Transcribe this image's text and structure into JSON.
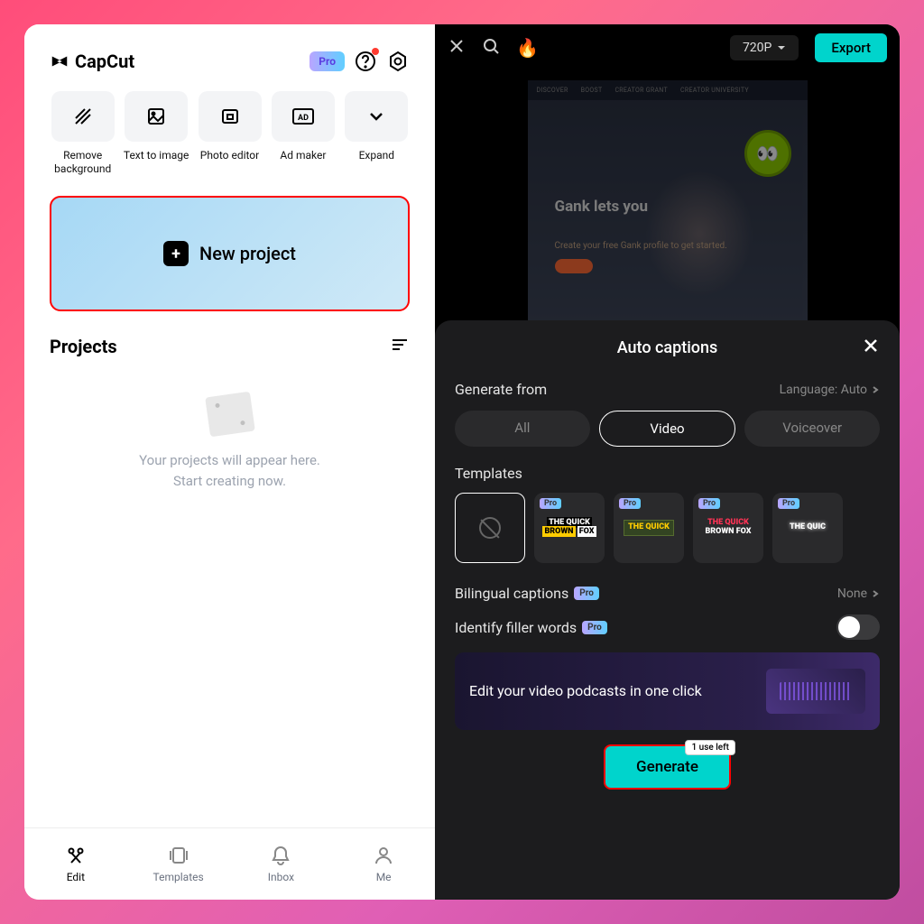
{
  "app_name": "CapCut",
  "pro_label": "Pro",
  "tools": [
    {
      "label": "Remove\nbackground"
    },
    {
      "label": "Text to image"
    },
    {
      "label": "Photo editor"
    },
    {
      "label": "Ad maker"
    },
    {
      "label": "Expand"
    }
  ],
  "new_project_label": "New project",
  "projects_title": "Projects",
  "empty_line1": "Your projects will appear here.",
  "empty_line2": "Start creating now.",
  "bottom_nav": [
    {
      "label": "Edit"
    },
    {
      "label": "Templates"
    },
    {
      "label": "Inbox"
    },
    {
      "label": "Me"
    }
  ],
  "editor": {
    "quality": "720P",
    "export_label": "Export",
    "preview_nav": [
      "DISCOVER",
      "BOOST",
      "CREATOR GRANT",
      "CREATOR UNIVERSITY"
    ],
    "gank_heading": "Gank lets you",
    "gank_sub": "Create your free Gank profile to get started."
  },
  "captions": {
    "title": "Auto captions",
    "generate_from_label": "Generate from",
    "language_label": "Language: Auto",
    "segments": [
      "All",
      "Video",
      "Voiceover"
    ],
    "templates_label": "Templates",
    "template_texts": [
      "",
      "THE QUICK BROWN FOX",
      "THE QUICK",
      "THE QUICK BROWN FOX",
      "THE QUIC"
    ],
    "bilingual_label": "Bilingual captions",
    "bilingual_value": "None",
    "filler_label": "Identify filler words",
    "promo_text": "Edit your video podcasts in one click",
    "generate_label": "Generate",
    "uses_left": "1 use left"
  }
}
